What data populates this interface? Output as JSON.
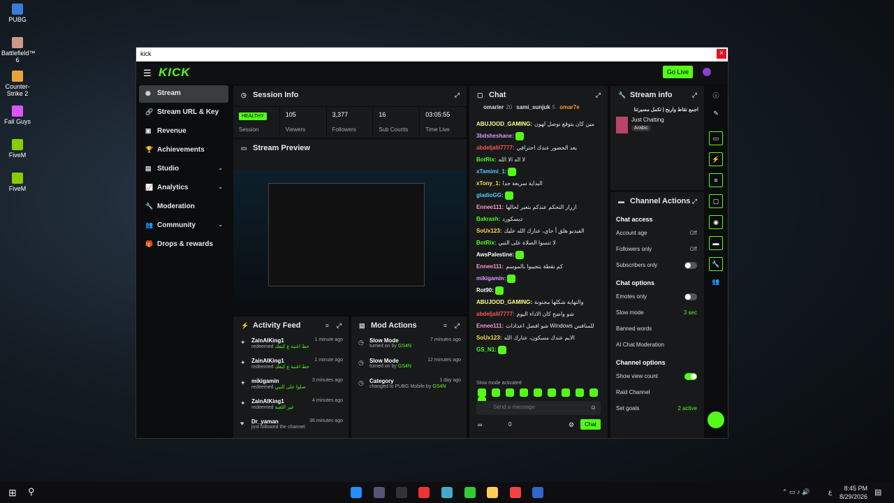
{
  "desktop_icons": [
    {
      "label": "PUBG",
      "color": "#3a7bd5"
    },
    {
      "label": "Battlefield™ 6",
      "color": "#c98"
    },
    {
      "label": "Counter-Strike 2",
      "color": "#e8a33d"
    },
    {
      "label": "Fall Guys",
      "color": "#d5f"
    },
    {
      "label": "FiveM",
      "color": "#8c0"
    },
    {
      "label": "FiveM",
      "color": "#8c0"
    }
  ],
  "window": {
    "title": "kick",
    "close": "×"
  },
  "topbar": {
    "logo": "KICK",
    "go_live": "Go Live"
  },
  "sidebar": [
    {
      "label": "Stream",
      "icon": "◉"
    },
    {
      "label": "Stream URL & Key",
      "icon": "🔗"
    },
    {
      "label": "Revenue",
      "icon": "▣"
    },
    {
      "label": "Achievements",
      "icon": "🏆"
    },
    {
      "label": "Studio",
      "icon": "▤"
    },
    {
      "label": "Analytics",
      "icon": "📈"
    },
    {
      "label": "Moderation",
      "icon": "🔧"
    },
    {
      "label": "Community",
      "icon": "👥"
    },
    {
      "label": "Drops & rewards",
      "icon": "🎁"
    }
  ],
  "session": {
    "title": "Session Info",
    "status": "HEALTHY",
    "status_label": "Session",
    "stats": [
      {
        "v": "105",
        "l": "Viewers"
      },
      {
        "v": "3,377",
        "l": "Followers"
      },
      {
        "v": "16",
        "l": "Sub Counts"
      },
      {
        "v": "03:05:55",
        "l": "Time Live"
      }
    ]
  },
  "preview": {
    "title": "Stream Preview"
  },
  "activity": {
    "title": "Activity Feed",
    "items": [
      {
        "n": "ZainAlKing1",
        "s": "redeemed",
        "r": "حط اغنية ع كيفك",
        "t": "1 minute ago"
      },
      {
        "n": "ZainAlKing1",
        "s": "redeemed",
        "r": "حط اغنية ع كيفك",
        "t": "1 minute ago"
      },
      {
        "n": "mikigamin",
        "s": "redeemed",
        "r": "صلوا على النبي",
        "t": "3 minutes ago"
      },
      {
        "n": "ZainAlKing1",
        "s": "redeemed",
        "r": "غير اللعبة",
        "t": "4 minutes ago"
      },
      {
        "n": "Dr_yaman",
        "s": "just followed the channel",
        "r": "",
        "t": "36 minutes ago"
      }
    ]
  },
  "mod": {
    "title": "Mod Actions",
    "items": [
      {
        "n": "Slow Mode",
        "s": "turned on by",
        "by": "GS4N",
        "t": "7 minutes ago"
      },
      {
        "n": "Slow Mode",
        "s": "turned on by",
        "by": "GS4N",
        "t": "12 minutes ago"
      },
      {
        "n": "Category",
        "s": "changed to PUBG Mobile by",
        "by": "GS4N",
        "t": "1 day ago"
      }
    ]
  },
  "chat": {
    "title": "Chat",
    "top": [
      {
        "n": "omarier",
        "c": "20"
      },
      {
        "n": "sami_sunjuk",
        "c": "5"
      },
      {
        "n": "omar7e",
        "c": ""
      }
    ],
    "messages": [
      {
        "u": "ABUJOOD_GAMING:",
        "c": "#ff8",
        "m": "مين كان يتوقع نوصل لهون"
      },
      {
        "u": "3bdsheshane:",
        "c": "#d9f",
        "m": ""
      },
      {
        "u": "abdeljalil7777:",
        "c": "#f55",
        "m": "بعد الحضور عندك احترافي"
      },
      {
        "u": "BotRix:",
        "c": "#53fc18",
        "m": "لا اله الا الله"
      },
      {
        "u": "xTamimi_1:",
        "c": "#5cf",
        "m": ""
      },
      {
        "u": "xTony_1:",
        "c": "#fd5",
        "m": "البداية سريعة جدا"
      },
      {
        "u": "gladioGG:",
        "c": "#5cf",
        "m": ""
      },
      {
        "u": "Ennee111:",
        "c": "#f9c",
        "m": "ازرار التحكم عندكم بتعبر لحالها"
      },
      {
        "u": "Bakrash:",
        "c": "#53fc18",
        "m": "ديسكورد"
      },
      {
        "u": "SoUx123:",
        "c": "#fd5",
        "m": "الفيديو هلق أ حاي، عنارك الله عليك"
      },
      {
        "u": "BotRix:",
        "c": "#53fc18",
        "m": "لا تنسوا الصلاة على النبي"
      },
      {
        "u": "AwsPalestine:",
        "c": "#fff",
        "m": ""
      },
      {
        "u": "Ennee111:",
        "c": "#f9c",
        "m": "كم نقطة بتجيبوا بالموسم"
      },
      {
        "u": "mikigamin:",
        "c": "#d9f",
        "m": ""
      },
      {
        "u": "Rot90:",
        "c": "#fff",
        "m": ""
      },
      {
        "u": "ABUJOOD_GAMING:",
        "c": "#ff8",
        "m": "والنهاية شكلها مجنونة"
      },
      {
        "u": "abdeljalil7777:",
        "c": "#f55",
        "m": "شو واضح كان الاداء اليوم"
      },
      {
        "u": "Ennee111:",
        "c": "#f9c",
        "m": "شو افضل اعدادات Windows للمنافس"
      },
      {
        "u": "SoUx123:",
        "c": "#fd5",
        "m": "الايم عندك مسكون، عنارك الله"
      },
      {
        "u": "GS_N1:",
        "c": "#53fc18",
        "m": ""
      }
    ],
    "slow": "Slow mode activated",
    "placeholder": "Send a message",
    "btn": "Chat",
    "count": "0",
    "inf": "∞"
  },
  "streaminfo": {
    "title": "Stream info",
    "name": "اجمع نقاط واربح | تكمل مسيرتنا",
    "category": "Just Chatting",
    "lang": "Arabic"
  },
  "channel": {
    "title": "Channel Actions",
    "access": {
      "title": "Chat access",
      "rows": [
        {
          "l": "Account age",
          "r": "Off"
        },
        {
          "l": "Followers only",
          "r": "Off"
        },
        {
          "l": "Subscribers only",
          "r": ""
        }
      ]
    },
    "options": {
      "title": "Chat options",
      "rows": [
        {
          "l": "Emotes only",
          "r": ""
        },
        {
          "l": "Slow mode",
          "r": "3 sec"
        },
        {
          "l": "Banned words",
          "r": ""
        },
        {
          "l": "AI Chat Moderation",
          "r": ""
        }
      ]
    },
    "chopt": {
      "title": "Channel options",
      "rows": [
        {
          "l": "Show view count",
          "r": ""
        },
        {
          "l": "Raid Channel",
          "r": ""
        },
        {
          "l": "Set goals",
          "r": "2 active"
        }
      ]
    }
  },
  "taskbar": {
    "time": "8:45 PM",
    "date": "8/29/2026",
    "lang": "ع"
  }
}
